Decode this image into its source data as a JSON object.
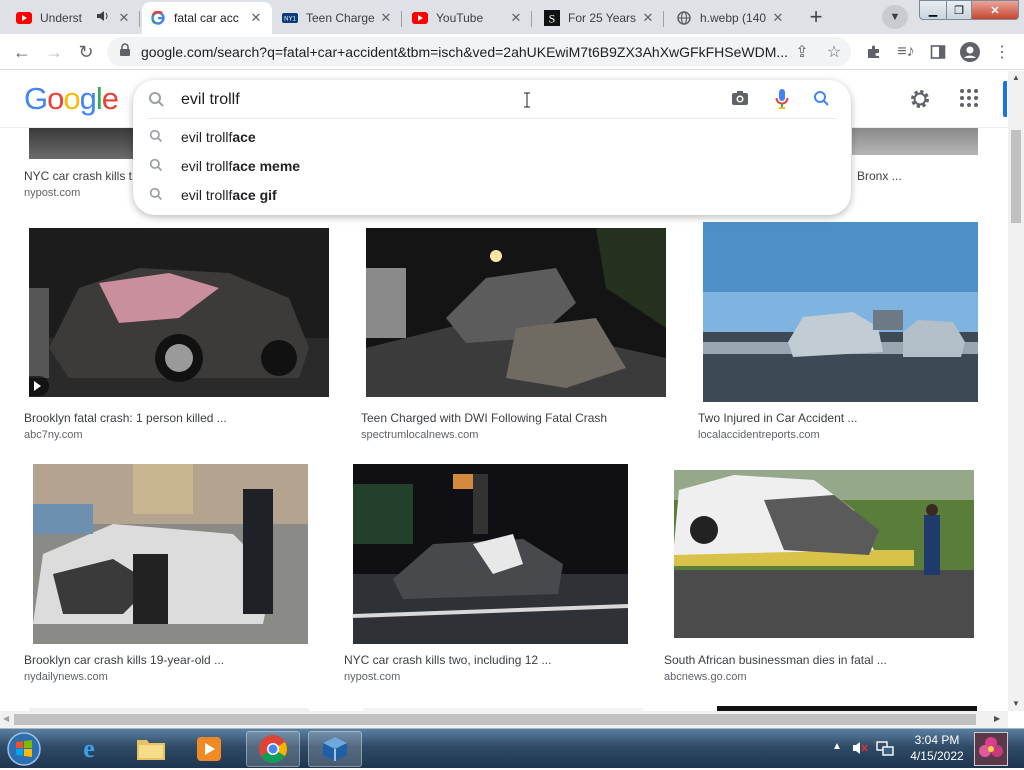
{
  "tabs": [
    {
      "title": "Underst",
      "icon": "youtube-icon",
      "audio": true
    },
    {
      "title": "fatal car acc",
      "icon": "google-icon",
      "active": true
    },
    {
      "title": "Teen Charge",
      "icon": "spectrum-news-icon"
    },
    {
      "title": "YouTube",
      "icon": "youtube-icon"
    },
    {
      "title": "For 25 Years",
      "icon": "s-letter-icon"
    },
    {
      "title": "h.webp (140",
      "icon": "globe-icon"
    }
  ],
  "toolbar": {
    "url": "google.com/search?q=fatal+car+accident&tbm=isch&ved=2ahUKEwiM7t6B9ZX3AhXwGFkFHSeWDM..."
  },
  "search": {
    "logo": "Google",
    "query": "evil trollf",
    "suggestions": [
      {
        "prefix": "evil trollf",
        "completion": "ace"
      },
      {
        "prefix": "evil trollf",
        "completion": "ace meme"
      },
      {
        "prefix": "evil trollf",
        "completion": "ace gif"
      }
    ]
  },
  "results_row0": [
    {
      "title": "NYC car crash kills t",
      "source": "nypost.com"
    },
    {
      "title": "Bronx ...",
      "source": ""
    }
  ],
  "results": [
    {
      "title": "Brooklyn fatal crash: 1 person killed ...",
      "source": "abc7ny.com"
    },
    {
      "title": "Teen Charged with DWI Following Fatal Crash",
      "source": "spectrumlocalnews.com"
    },
    {
      "title": "Two Injured in Car Accident ...",
      "source": "localaccidentreports.com"
    },
    {
      "title": "Brooklyn car crash kills 19-year-old ...",
      "source": "nydailynews.com"
    },
    {
      "title": "NYC car crash kills two, including 12 ...",
      "source": "nypost.com"
    },
    {
      "title": "South African businessman dies in fatal ...",
      "source": "abcnews.go.com"
    }
  ],
  "taskbar": {
    "time": "3:04 PM",
    "date": "4/15/2022"
  },
  "colors": {
    "google_blue": "#4285f4",
    "google_red": "#ea4335",
    "google_yellow": "#fbbc05",
    "google_green": "#34a853",
    "link_blue": "#1a73e8"
  }
}
